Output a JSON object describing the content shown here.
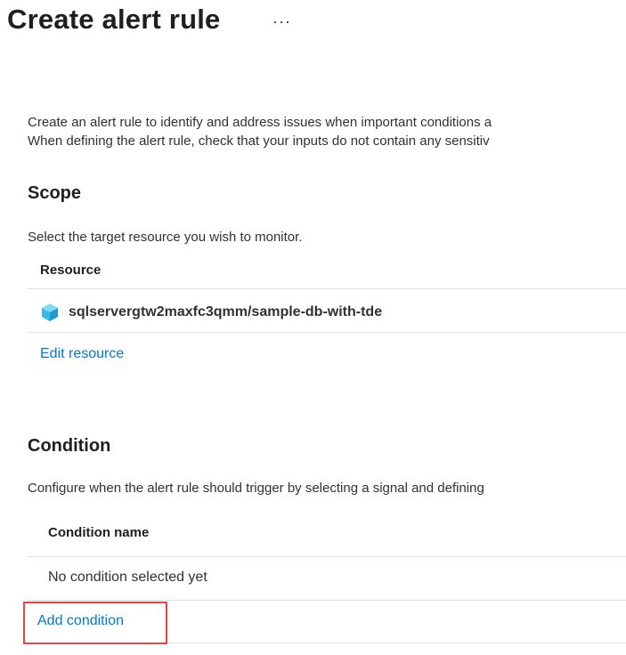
{
  "header": {
    "title": "Create alert rule",
    "more_label": "···"
  },
  "intro": {
    "line1": "Create an alert rule to identify and address issues when important conditions a",
    "line2": "When defining the alert rule, check that your inputs do not contain any sensitiv"
  },
  "scope": {
    "heading": "Scope",
    "description": "Select the target resource you wish to monitor.",
    "column_header": "Resource",
    "resource_name": "sqlservergtw2maxfc3qmm/sample-db-with-tde",
    "resource_icon": "sql-database-icon",
    "edit_link": "Edit resource"
  },
  "condition": {
    "heading": "Condition",
    "description": "Configure when the alert rule should trigger by selecting a signal and defining",
    "column_header": "Condition name",
    "empty_text": "No condition selected yet",
    "add_link": "Add condition",
    "highlight_color": "#e24646"
  },
  "colors": {
    "link": "#0078d4",
    "divider": "#e1dfdd",
    "text": "#323130"
  }
}
